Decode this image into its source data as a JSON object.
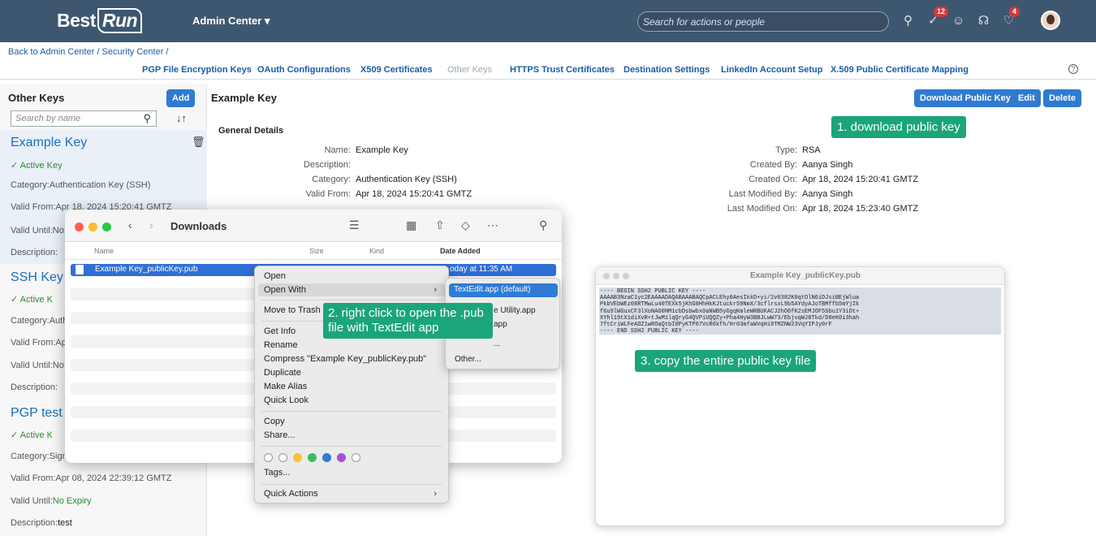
{
  "shell": {
    "logo_prefix": "Best",
    "logo_run": "Run",
    "admin_center": "Admin Center ▾",
    "search_placeholder": "Search for actions or people",
    "badge_tasks": "12",
    "badge_notifications": "4"
  },
  "breadcrumb": "Back to Admin Center / Security Center /",
  "tabs": [
    "PGP File Encryption Keys",
    "OAuth Configurations",
    "X509 Certificates",
    "Other Keys",
    "HTTPS Trust Certificates",
    "Destination Settings",
    "LinkedIn Account Setup",
    "X.509 Public Certificate Mapping"
  ],
  "active_tab": "Other Keys",
  "left": {
    "title": "Other Keys",
    "add_label": "Add",
    "search_placeholder": "Search by name",
    "keys": [
      {
        "name": "Example Key",
        "status": "Active Key",
        "category": "Category:Authentication Key (SSH)",
        "valid_from": "Valid From:Apr 18, 2024 15:20:41 GMTZ",
        "valid_until": "Valid Until:No",
        "description": "Description:"
      },
      {
        "name": "SSH Key I",
        "status": "Active K",
        "category": "Category:Auth",
        "valid_from": "Valid From:Ap",
        "valid_until": "Valid Until:No",
        "description": "Description:"
      },
      {
        "name": "PGP test",
        "status": "Active K",
        "category": "Category:Sign",
        "valid_from": "Valid From:Apr 08, 2024 22:39:12 GMTZ",
        "valid_until_label": "Valid Until:",
        "valid_until_value": "No Expiry",
        "description_label": "Description:",
        "description_value": "test"
      }
    ]
  },
  "detail": {
    "title": "Example Key",
    "download_label": "Download Public Key",
    "edit_label": "Edit",
    "delete_label": "Delete",
    "section": "General Details",
    "left_rows": [
      {
        "label": "Name:",
        "value": "Example Key"
      },
      {
        "label": "Description:",
        "value": ""
      },
      {
        "label": "Category:",
        "value": "Authentication Key (SSH)"
      },
      {
        "label": "Valid From:",
        "value": "Apr 18, 2024 15:20:41 GMTZ"
      }
    ],
    "right_rows": [
      {
        "label": "Type:",
        "value": "RSA"
      },
      {
        "label": "Created By:",
        "value": "Aanya Singh"
      },
      {
        "label": "Created On:",
        "value": "Apr 18, 2024 15:20:41 GMTZ"
      },
      {
        "label": "Last Modified By:",
        "value": "Aanya Singh"
      },
      {
        "label": "Last Modified On:",
        "value": "Apr 18, 2024 15:23:40 GMTZ"
      }
    ]
  },
  "callouts": {
    "step1": "1. download public key",
    "step2": "2. right click to open the .pub file with TextEdit app",
    "step3": "3. copy the entire public key file"
  },
  "finder": {
    "title": "Downloads",
    "columns": {
      "name": "Name",
      "size": "Size",
      "kind": "Kind",
      "date": "Date Added"
    },
    "file_name": "Example Key_publicKey.pub",
    "file_date": "oday at 11:35 AM"
  },
  "context_menu": {
    "open": "Open",
    "open_with": "Open With",
    "move_to_trash": "Move to Trash",
    "get_info": "Get Info",
    "rename": "Rename",
    "compress": "Compress \"Example Key_publicKey.pub\"",
    "duplicate": "Duplicate",
    "make_alias": "Make Alias",
    "quick_look": "Quick Look",
    "copy": "Copy",
    "share": "Share...",
    "tags": "Tags...",
    "quick_actions": "Quick Actions",
    "tag_colors": [
      "#ffffff",
      "#ffffff",
      "#f5c236",
      "#3bbf5b",
      "#2f7bd6",
      "#a551d6",
      "#ffffff"
    ]
  },
  "submenu": {
    "textedit": "TextEdit.app (default)",
    "item2": "e Utility.app",
    "item3": "app",
    "item4": "...",
    "item5": "Other..."
  },
  "textedit": {
    "title": "Example Key_publicKey.pub",
    "content": "---- BEGIN SSH2 PUBLIC KEY ----\nAAAAB3NzaC1yc2EAAAADAQABAAABAQCpACLEhy0AesIkkD+yi/2v0382K0qtOlN6iDJsiBEjWlua\nPkbVEbWEz08RTMwLu40TEXk5jKhG0HhHkKJtuckr59NmX/3cflrsxL9b5AYdyAJoTBMffb5mYjIk\nfGu9lWGuxCF3lXoNAG0NM1cbDsbwbx0aNWB5yGgqKmleWRBUKACJ2hO6fK2sEMJOF5Sbu1Y3iOt+\nXYhl19tX1diXvR+tJwM1lqQryG4QVPiUQQZy+Pha4HyW3BBJLwW73/EbjvqWJ8Tkd/D8eK0i3hah\n7ftCriWLFeADZ1wROaQtbI0PyKTP07VcR6kfh/Hr03mfaWVqHi9TMZNW23VqYIPJy0rF\n---- END SSH2 PUBLIC KEY ----"
  }
}
